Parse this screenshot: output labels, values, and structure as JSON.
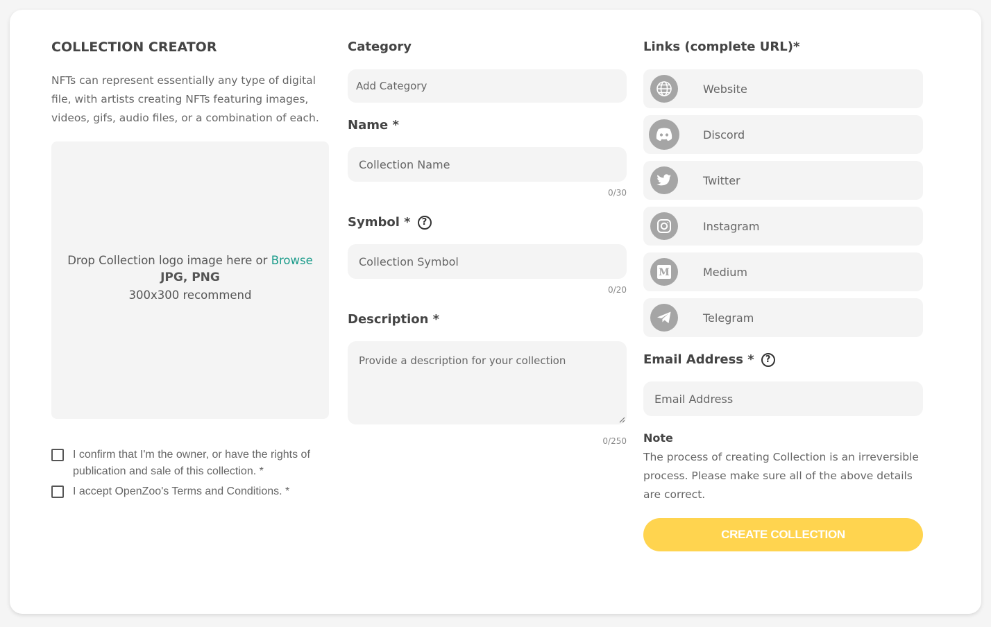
{
  "creator": {
    "title": "COLLECTION CREATOR",
    "intro": "NFTs can represent essentially any type of digital file, with artists creating NFTs featuring images, videos, gifs, audio files, or a combination of each.",
    "dropzone": {
      "text": "Drop Collection logo image here or ",
      "browse": "Browse",
      "types": "JPG, PNG",
      "recommend": "300x300 recommend"
    },
    "confirm_owner": "I confirm that I'm the owner, or have the rights of publication and sale of this collection. *",
    "accept_terms": "I accept OpenZoo's Terms and Conditions. *"
  },
  "form": {
    "category_label": "Category",
    "category_placeholder": "Add Category",
    "name_label": "Name *",
    "name_placeholder": "Collection Name",
    "name_counter": "0/30",
    "symbol_label": "Symbol *",
    "symbol_placeholder": "Collection Symbol",
    "symbol_counter": "0/20",
    "description_label": "Description *",
    "description_placeholder": "Provide a description for your collection",
    "description_counter": "0/250",
    "help_glyph": "?"
  },
  "links": {
    "label": "Links (complete URL)*",
    "items": [
      {
        "label": "Website",
        "icon": "globe-icon"
      },
      {
        "label": "Discord",
        "icon": "discord-icon"
      },
      {
        "label": "Twitter",
        "icon": "twitter-icon"
      },
      {
        "label": "Instagram",
        "icon": "instagram-icon"
      },
      {
        "label": "Medium",
        "icon": "medium-icon"
      },
      {
        "label": "Telegram",
        "icon": "telegram-icon"
      }
    ],
    "email_label": "Email Address *",
    "email_placeholder": "Email Address",
    "note_title": "Note",
    "note_text": "The process of creating Collection is an irreversible process. Please make sure all of the above details are correct.",
    "create_button": "CREATE COLLECTION"
  },
  "colors": {
    "accent_yellow": "#ffd44f",
    "browse_link": "#1a9b8a",
    "field_bg": "#f4f4f4",
    "icon_gray": "#a5a5a5"
  }
}
